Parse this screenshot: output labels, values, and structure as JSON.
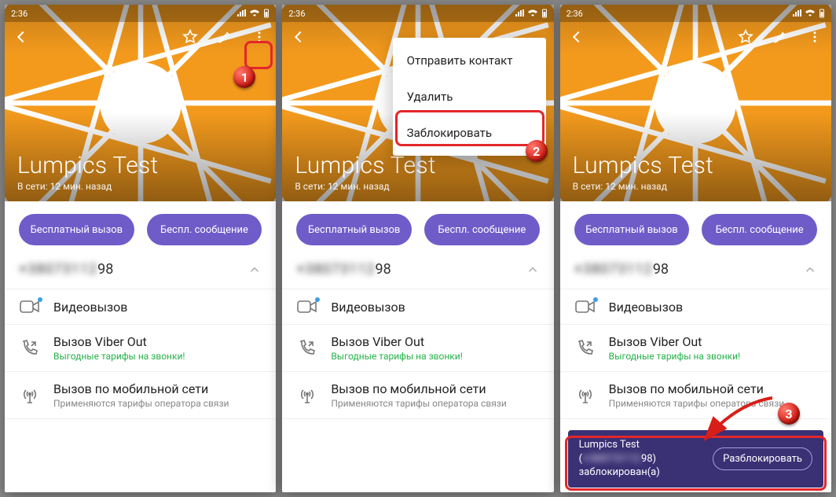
{
  "statusbar": {
    "time": "2:36"
  },
  "contact": {
    "name": "Lumpics Test",
    "last_seen": "В сети: 12 мин. назад",
    "phone_blurred": "+38073112",
    "phone_clear": "98"
  },
  "buttons": {
    "free_call": "Бесплатный вызов",
    "free_message": "Беспл. сообщение"
  },
  "rows": {
    "video": {
      "title": "Видеовызов"
    },
    "viberout": {
      "title": "Вызов Viber Out",
      "sub": "Выгодные тарифы на звонки!"
    },
    "cellular": {
      "title": "Вызов по мобильной сети",
      "sub": "Применяются тарифы оператора связи"
    }
  },
  "menu": {
    "send_contact": "Отправить контакт",
    "delete": "Удалить",
    "block": "Заблокировать"
  },
  "toast": {
    "line1": "Lumpics Test",
    "line2_prefix": "(",
    "line2_blurred": "+38073112",
    "line2_suffix": "98)",
    "line3": "заблокирован(а)",
    "button": "Разблокировать"
  },
  "markers": {
    "m1": "1",
    "m2": "2",
    "m3": "3"
  }
}
